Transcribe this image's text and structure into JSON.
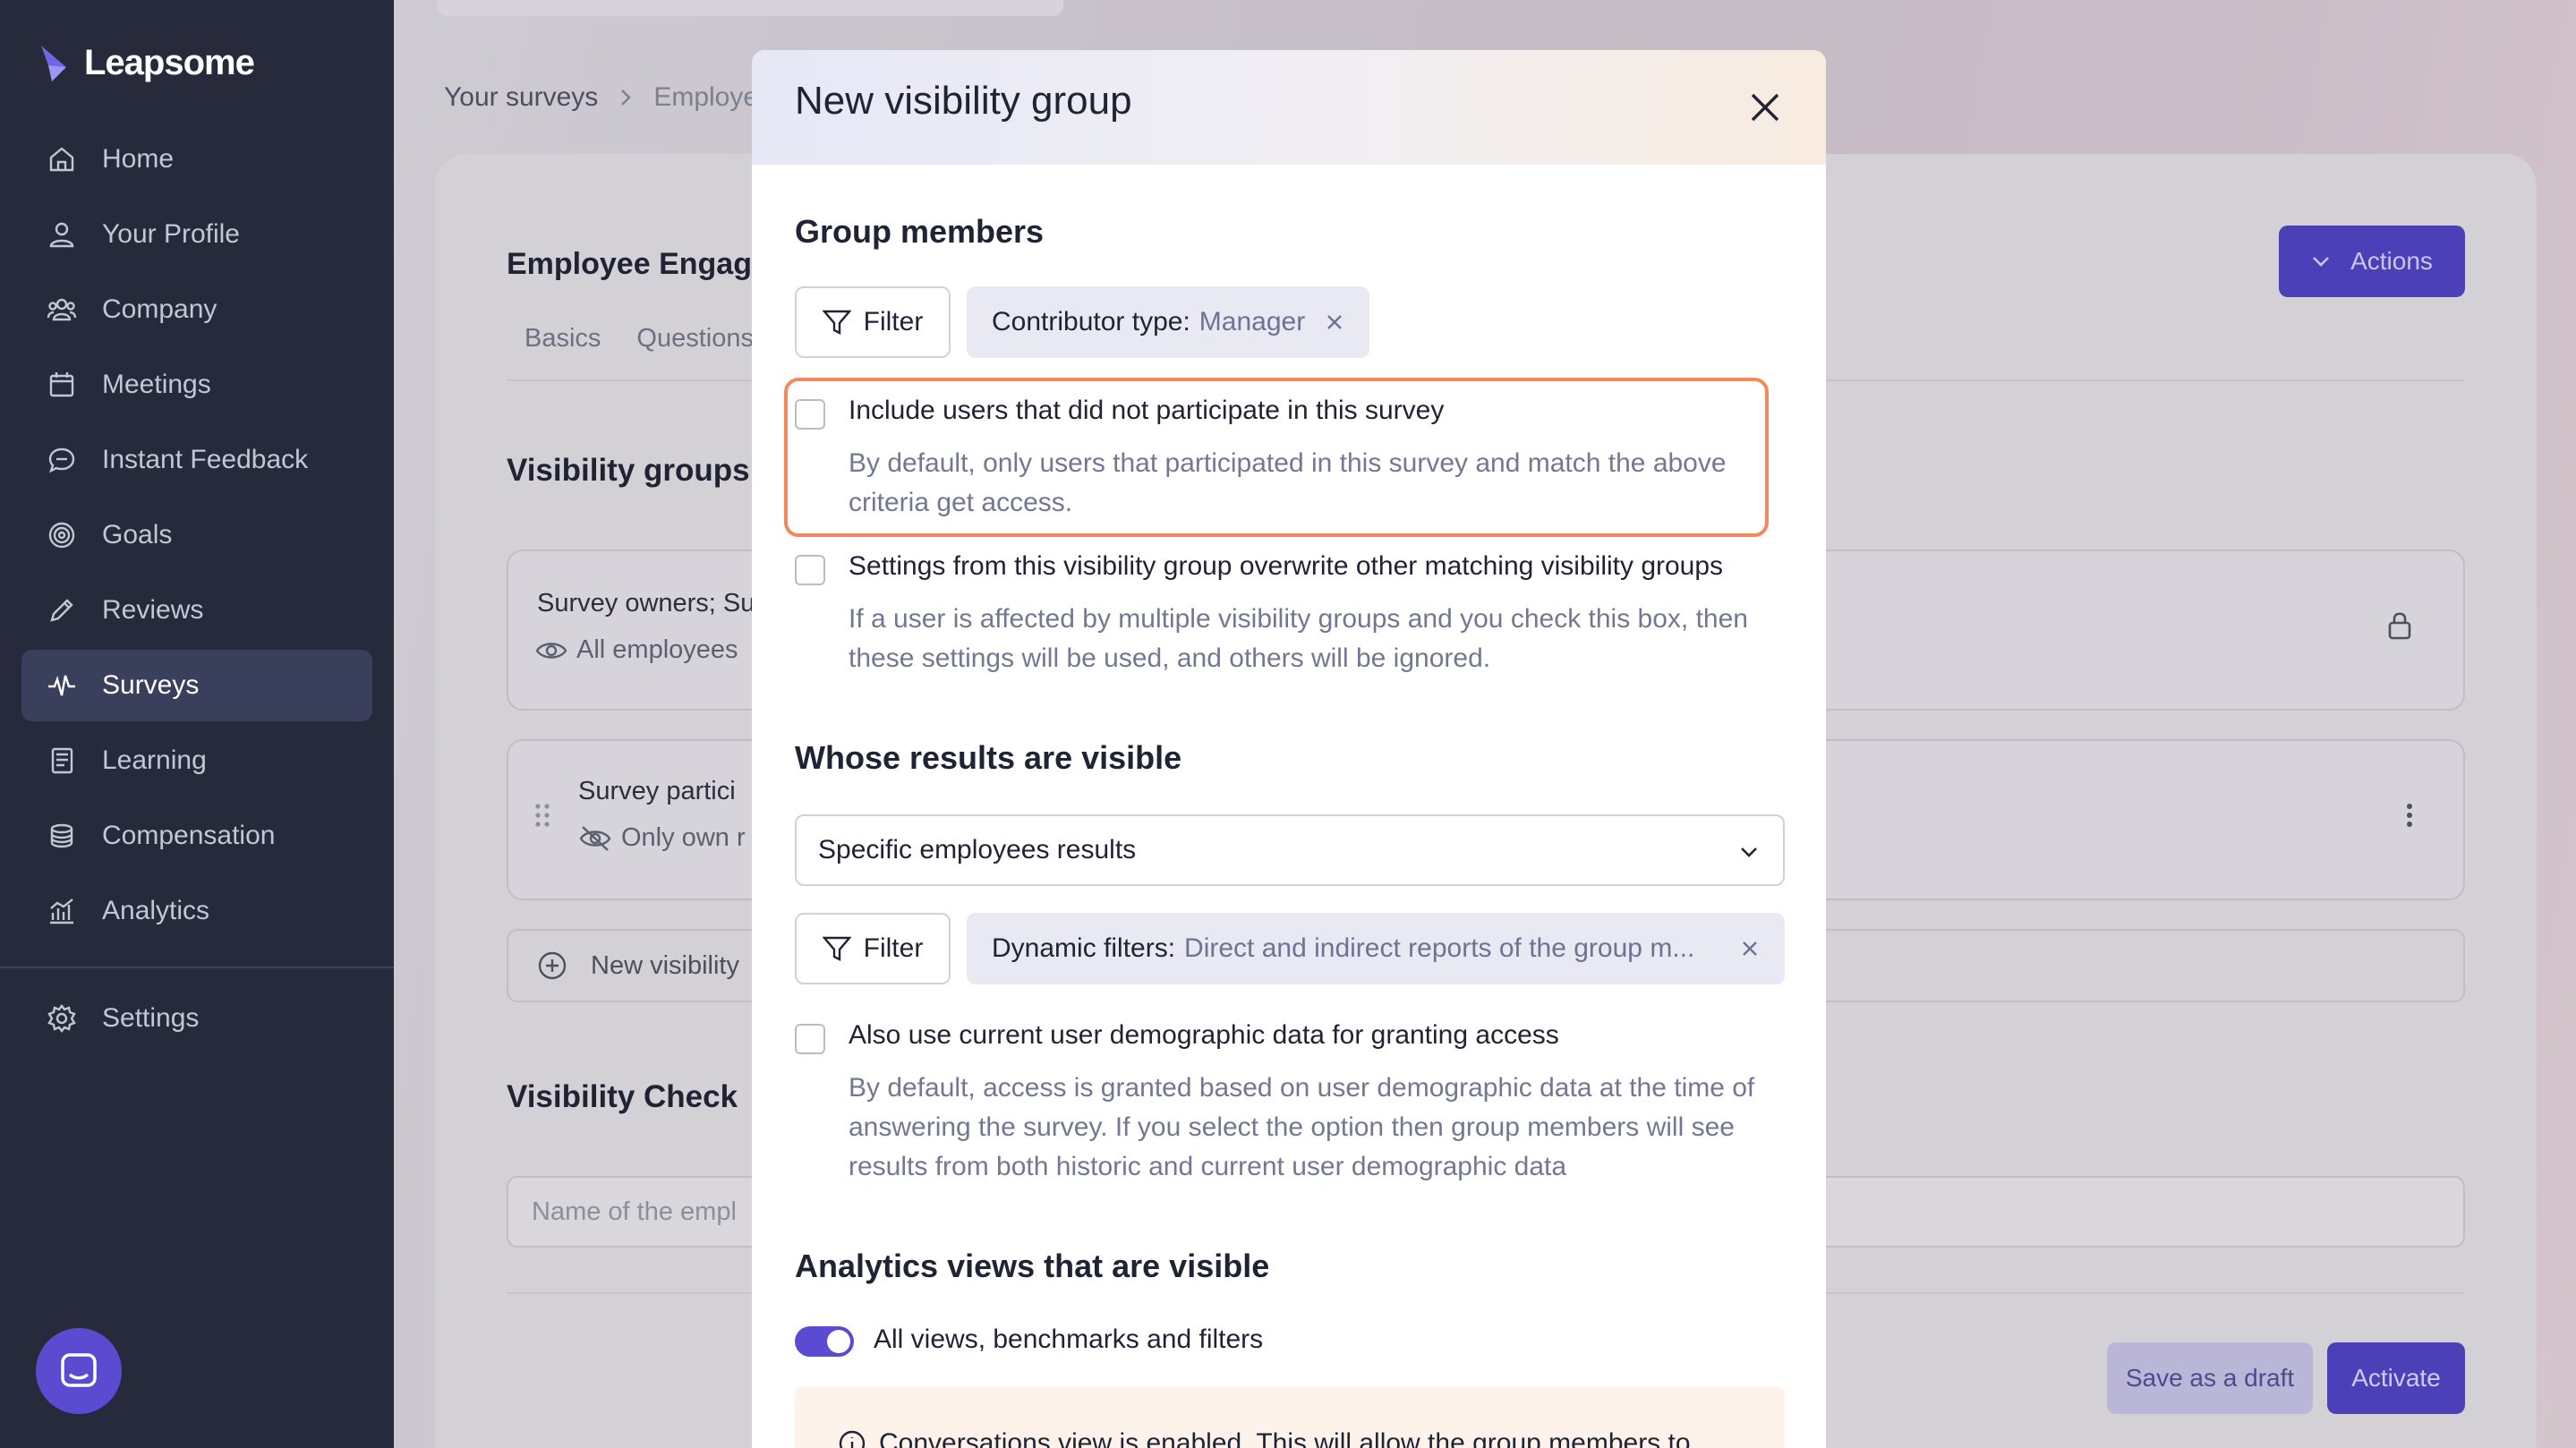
{
  "app": {
    "brand": "Leapsome",
    "accent": "#5a4bd0",
    "sidebar_bg": "#262a3b"
  },
  "sidebar": {
    "items": [
      {
        "label": "Home",
        "icon": "home-icon"
      },
      {
        "label": "Your Profile",
        "icon": "user-icon"
      },
      {
        "label": "Company",
        "icon": "users-icon"
      },
      {
        "label": "Meetings",
        "icon": "calendar-icon"
      },
      {
        "label": "Instant Feedback",
        "icon": "chat-icon"
      },
      {
        "label": "Goals",
        "icon": "target-icon"
      },
      {
        "label": "Reviews",
        "icon": "pencil-icon"
      },
      {
        "label": "Surveys",
        "icon": "pulse-icon",
        "active": true
      },
      {
        "label": "Learning",
        "icon": "book-icon"
      },
      {
        "label": "Compensation",
        "icon": "coins-icon"
      },
      {
        "label": "Analytics",
        "icon": "chart-icon"
      }
    ],
    "settings": {
      "label": "Settings",
      "icon": "gear-icon"
    }
  },
  "page": {
    "breadcrumb": {
      "first": "Your surveys",
      "second": "Employe"
    },
    "title": "Employee Engag",
    "tabs": [
      "Basics",
      "Questions"
    ],
    "actions_label": "Actions",
    "visibility_groups_heading": "Visibility groups",
    "rows": [
      {
        "title": "Survey owners; Su",
        "sub": "All employees"
      },
      {
        "title": "Survey partici",
        "sub": "Only own r"
      }
    ],
    "new_visibility_label": "New visibility",
    "visibility_check_heading": "Visibility Check",
    "check_placeholder": "Name of the empl",
    "save_draft_label": "Save as a draft",
    "activate_label": "Activate"
  },
  "modal": {
    "title": "New visibility group",
    "group_members": {
      "heading": "Group members",
      "filter_label": "Filter",
      "chip_key": "Contributor type:",
      "chip_value": "Manager",
      "options": [
        {
          "label": "Include users that did not participate in this survey",
          "description": "By default, only users that participated in this survey and match the above criteria get access.",
          "checked": false
        },
        {
          "label": "Settings from this visibility group overwrite other matching visibility groups",
          "description": "If a user is affected by multiple visibility groups and you check this box, then these settings will be used, and others will be ignored.",
          "checked": false
        }
      ]
    },
    "whose_results": {
      "heading": "Whose results are visible",
      "selected": "Specific employees results",
      "filter_label": "Filter",
      "chip_key": "Dynamic filters:",
      "chip_value": "Direct and indirect reports of the group m...",
      "option": {
        "label": "Also use current user demographic data for granting access",
        "description": "By default, access is granted based on user demographic data at the time of answering the survey. If you select the option then group members will see results from both historic and current user demographic data",
        "checked": false
      }
    },
    "analytics_views": {
      "heading": "Analytics views that are visible",
      "toggle_label": "All views, benchmarks and filters",
      "toggle_on": true,
      "info_text": "Conversations view is enabled. This will allow the group members to"
    }
  }
}
